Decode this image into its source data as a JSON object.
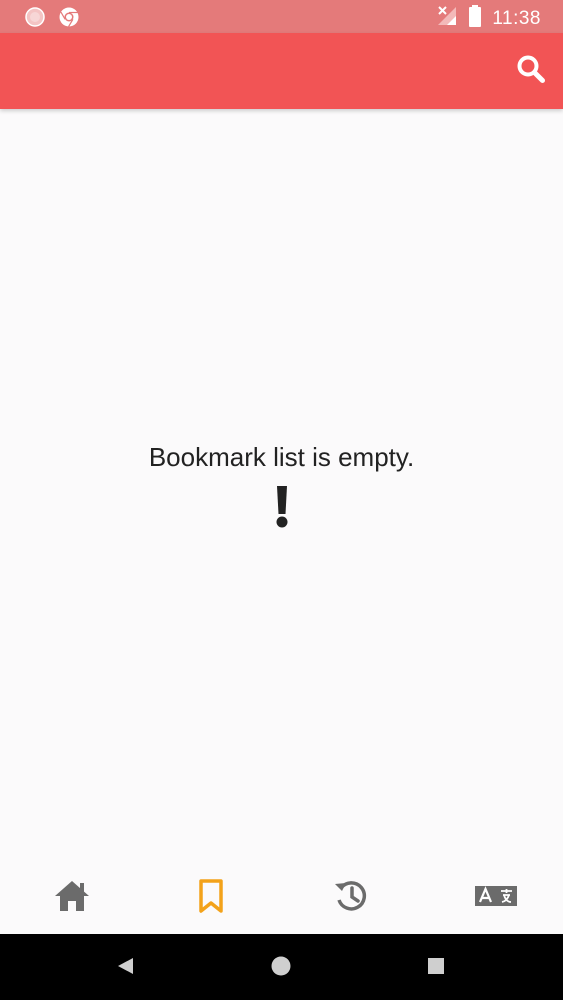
{
  "status_bar": {
    "time": "11:38",
    "icons": [
      "notification-dot-icon",
      "chrome-icon",
      "signal-icon",
      "battery-icon"
    ]
  },
  "app_bar": {
    "background": "#f25455",
    "actions": [
      "search-icon"
    ]
  },
  "empty_state": {
    "message": "Bookmark list is empty.",
    "icon": "exclamation-icon"
  },
  "bottom_nav": {
    "items": [
      {
        "icon": "home-icon",
        "active": false
      },
      {
        "icon": "bookmark-icon",
        "active": true
      },
      {
        "icon": "history-icon",
        "active": false
      },
      {
        "icon": "translate-icon",
        "active": false
      }
    ],
    "active_color": "#f3a21a",
    "inactive_color": "#6b6b6b"
  },
  "system_nav": {
    "buttons": [
      "back-icon",
      "home-circle-icon",
      "recents-icon"
    ]
  }
}
